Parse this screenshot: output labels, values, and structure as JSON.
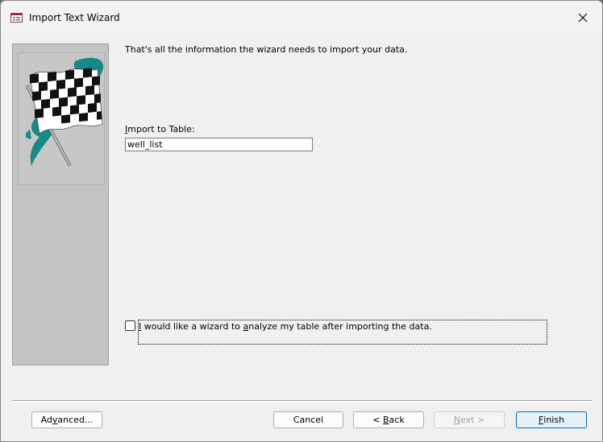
{
  "window": {
    "title": "Import Text Wizard",
    "close_icon": "close-icon",
    "app_icon": "form-icon"
  },
  "panel": {
    "image": "checkered-flag-icon"
  },
  "main": {
    "intro": "That's all the information the wizard needs to import your data.",
    "import_label_prefix": "",
    "import_label_mnemonic": "I",
    "import_label_rest": "mport to Table:",
    "table_name": "well_list",
    "analyze": {
      "checked": false,
      "label_mnemonic1": "I",
      "label_part1": " would like a wizard to ",
      "label_mnemonic2": "a",
      "label_part2": "nalyze my table after importing the data."
    }
  },
  "buttons": {
    "advanced": {
      "pre": "Ad",
      "key": "v",
      "post": "anced..."
    },
    "cancel": {
      "label": "Cancel"
    },
    "back": {
      "pre": "< ",
      "key": "B",
      "post": "ack"
    },
    "next": {
      "pre": "",
      "key": "N",
      "post": "ext >"
    },
    "finish": {
      "pre": "",
      "key": "F",
      "post": "inish"
    }
  },
  "colors": {
    "flag_teal": "#178a87",
    "default_button_border": "#0067c0"
  }
}
